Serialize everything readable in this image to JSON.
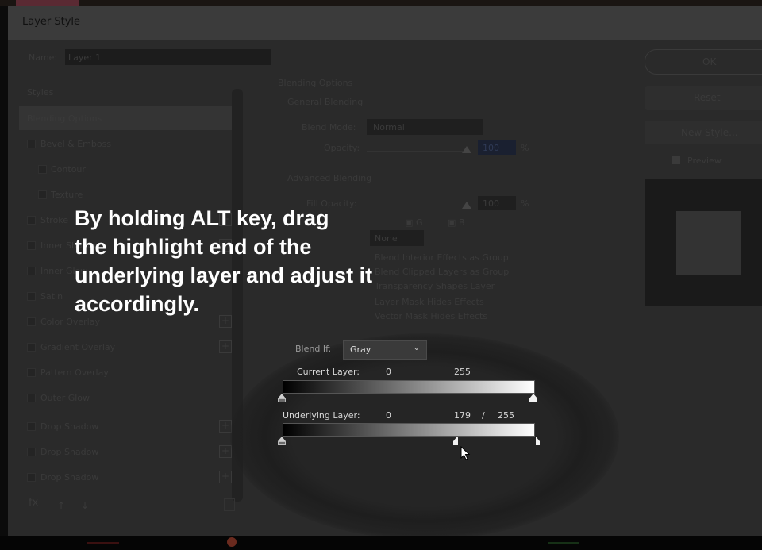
{
  "dialog": {
    "title": "Layer Style",
    "name_label": "Name:",
    "name_value": "Layer 1"
  },
  "styles_panel": {
    "header": "Styles",
    "items": [
      {
        "label": "Blending Options",
        "selected": true
      },
      {
        "label": "Bevel & Emboss"
      },
      {
        "label": "Contour"
      },
      {
        "label": "Texture"
      },
      {
        "label": "Stroke"
      },
      {
        "label": "Inner Shadow"
      },
      {
        "label": "Inner Glow"
      },
      {
        "label": "Satin"
      },
      {
        "label": "Color Overlay"
      },
      {
        "label": "Gradient Overlay"
      },
      {
        "label": "Pattern Overlay"
      },
      {
        "label": "Outer Glow"
      },
      {
        "label": "Drop Shadow"
      },
      {
        "label": "Drop Shadow"
      },
      {
        "label": "Drop Shadow"
      }
    ],
    "fx_label": "fx"
  },
  "blending_options": {
    "heading": "Blending Options",
    "general_heading": "General Blending",
    "blend_mode_label": "Blend Mode:",
    "blend_mode_value": "Normal",
    "opacity_label": "Opacity:",
    "opacity_value": "100",
    "percent": "%",
    "advanced_heading": "Advanced Blending",
    "fill_opacity_label": "Fill Opacity:",
    "fill_opacity_value": "100",
    "channel_g": "G",
    "channel_b": "B",
    "knockout_value": "None",
    "checkbox_items": [
      "Blend Interior Effects as Group",
      "Blend Clipped Layers as Group",
      "Transparency Shapes Layer",
      "Layer Mask Hides Effects",
      "Vector Mask Hides Effects"
    ]
  },
  "blend_if": {
    "label": "Blend If:",
    "value": "Gray",
    "current_layer_label": "Current Layer:",
    "current_low": "0",
    "current_high": "255",
    "underlying_layer_label": "Underlying Layer:",
    "underlying_low": "0",
    "underlying_split_low": "179",
    "separator": "/",
    "underlying_split_high": "255"
  },
  "side_buttons": {
    "ok": "OK",
    "reset": "Reset",
    "new_style": "New Style...",
    "preview": "Preview"
  },
  "overlay_caption": [
    "By holding ALT key, drag",
    "the highlight end of the",
    "underlying layer and adjust it",
    "accordingly."
  ]
}
